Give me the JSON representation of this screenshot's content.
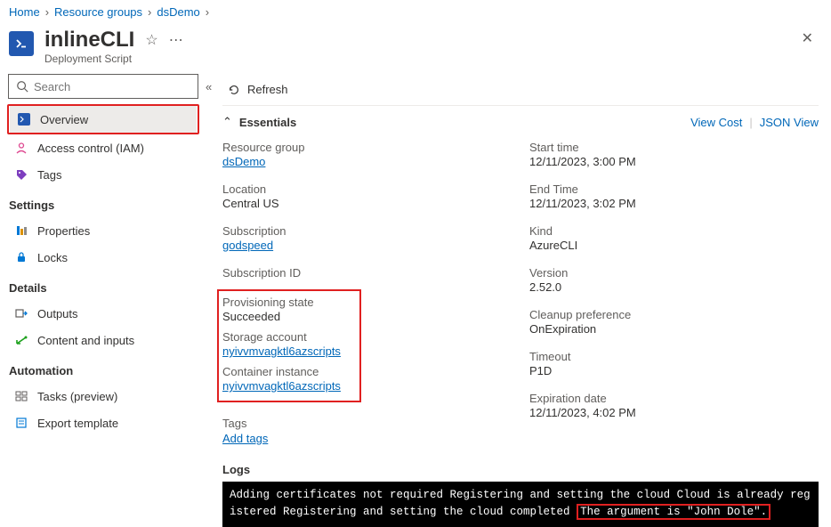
{
  "breadcrumb": [
    "Home",
    "Resource groups",
    "dsDemo"
  ],
  "header": {
    "title": "inlineCLI",
    "subtitle": "Deployment Script"
  },
  "sidebar": {
    "searchPlaceholder": "Search",
    "items": [
      {
        "id": "overview",
        "label": "Overview",
        "selected": true
      },
      {
        "id": "access",
        "label": "Access control (IAM)"
      },
      {
        "id": "tags",
        "label": "Tags"
      }
    ],
    "settingsHeader": "Settings",
    "settings": [
      {
        "id": "properties",
        "label": "Properties"
      },
      {
        "id": "locks",
        "label": "Locks"
      }
    ],
    "detailsHeader": "Details",
    "details": [
      {
        "id": "outputs",
        "label": "Outputs"
      },
      {
        "id": "content",
        "label": "Content and inputs"
      }
    ],
    "automationHeader": "Automation",
    "automation": [
      {
        "id": "tasks",
        "label": "Tasks (preview)"
      },
      {
        "id": "export",
        "label": "Export template"
      }
    ]
  },
  "toolbar": {
    "refresh": "Refresh"
  },
  "essentials": {
    "title": "Essentials",
    "viewCost": "View Cost",
    "jsonView": "JSON View",
    "left": {
      "resourceGroupLabel": "Resource group",
      "resourceGroupValue": "dsDemo",
      "locationLabel": "Location",
      "locationValue": "Central US",
      "subscriptionLabel": "Subscription",
      "subscriptionValue": "godspeed",
      "subscriptionIdLabel": "Subscription ID",
      "provisioningLabel": "Provisioning state",
      "provisioningValue": "Succeeded",
      "storageLabel": "Storage account",
      "storageValue": "nyivvmvagktl6azscripts",
      "containerLabel": "Container instance",
      "containerValue": "nyivvmvagktl6azscripts",
      "tagsLabel": "Tags",
      "tagsValue": "Add tags"
    },
    "right": {
      "startLabel": "Start time",
      "startValue": "12/11/2023, 3:00 PM",
      "endLabel": "End Time",
      "endValue": "12/11/2023, 3:02 PM",
      "kindLabel": "Kind",
      "kindValue": "AzureCLI",
      "versionLabel": "Version",
      "versionValue": "2.52.0",
      "cleanupLabel": "Cleanup preference",
      "cleanupValue": "OnExpiration",
      "timeoutLabel": "Timeout",
      "timeoutValue": "P1D",
      "expirationLabel": "Expiration date",
      "expirationValue": "12/11/2023, 4:02 PM"
    }
  },
  "logs": {
    "title": "Logs",
    "prefix": "Adding certificates not required Registering and setting the cloud Cloud is already registered Registering and setting the cloud completed ",
    "highlight": "The argument is \"John Dole\"."
  }
}
